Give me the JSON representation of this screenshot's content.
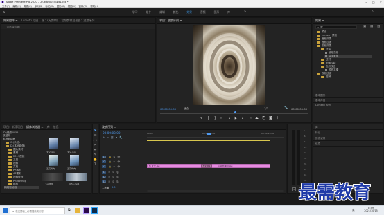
{
  "titlebar": {
    "app_title": "Adobe Premiere Pro 2020 - D:\\视频\\0055\\新建项目 *",
    "menus": [
      "文件(F)",
      "编辑(E)",
      "剪辑(C)",
      "序列(S)",
      "标记(M)",
      "图形(G)",
      "视图(V)",
      "窗口(W)",
      "帮助(H)"
    ]
  },
  "workspaces": {
    "items": [
      "学习",
      "组件",
      "编辑",
      "颜色",
      "效果",
      "音频",
      "图形",
      "库"
    ],
    "active_index": 4
  },
  "source_panel": {
    "tabs": [
      "效果控件 ≡",
      "Lumetri 范围",
      "源：(无剪辑)",
      "音频剪辑混合器：波浪序列"
    ],
    "message": "（未选择剪辑）"
  },
  "program_monitor": {
    "tab": "节目：波浪序列 ≡",
    "timecode_left": "00:00:00:00",
    "fit": "适合",
    "scale": "1/2",
    "timecode_right": "00:00:05:00"
  },
  "effects_panel": {
    "tab": "效果 ≡",
    "search_value": "波",
    "tree": [
      "预设",
      "Lumetri 预设",
      "音频效果",
      "音频过渡",
      "视频效果",
      "扭曲",
      "波形变形",
      "湍流置换",
      "过时",
      "图像控制",
      "色彩校正",
      "颜色平衡",
      "视频过渡",
      "溶解"
    ],
    "sections": [
      "基本图形",
      "基本声音",
      "Lumetri 颜色",
      "库",
      "标记",
      "历史记录",
      "信息"
    ]
  },
  "project_panel": {
    "tabs": [
      "项目：新建项目",
      "媒体浏览器 ≡",
      "库",
      "信息"
    ],
    "path": "D:\\视频\\0055",
    "folders": [
      "收藏夹",
      "本地驱动器",
      "C:(系统)",
      "D:(本地磁盘)",
      "图片素材",
      "素材",
      "2019视频",
      "工具",
      "视频",
      "文档",
      "PR素材",
      "AE素材",
      "视频教程",
      "Photoshop",
      "模板",
      "网络驱动器"
    ],
    "thumbnails": [
      "天空.jpg",
      "天空.jpg",
      "五花烤肉",
      "五花烤肉",
      "五花肉烤",
      "0055.mp4"
    ]
  },
  "timeline": {
    "tab": "波浪序列 ≡",
    "timecode": "00:00:03:00",
    "ruler": [
      "00:00",
      "00:00:05:00",
      "00:00:10:00"
    ],
    "video_tracks": [
      "V3",
      "V2",
      "V1"
    ],
    "audio_tracks": [
      "A1",
      "A2",
      "A3"
    ],
    "master_label": "主声道",
    "master_value": "0.0",
    "clips": [
      {
        "label": "fx 天空.jpg",
        "color": "#e78be0"
      },
      {
        "label": "fx 蓝色湖泊.jpg",
        "color": "#e78be0"
      }
    ],
    "transition_label": "交叉溶解"
  },
  "meters": {
    "scale": [
      "0",
      "-6",
      "-12",
      "-18",
      "-24",
      "-30",
      "-36",
      "-42",
      "-48",
      "-54"
    ],
    "labels": [
      "S",
      "S"
    ]
  },
  "watermark": {
    "text": "最需教育"
  },
  "taskbar": {
    "search_placeholder": "在这里输入你要搜索的内容",
    "time": "8:49",
    "date": "2021/10/15",
    "lang": "英"
  },
  "colors": {
    "accent": "#3a8fd8",
    "timecode_blue": "#4e9af1",
    "clip_pink": "#e78be0",
    "folder": "#c9a23b",
    "workspace_active": "#3a8fd8"
  }
}
